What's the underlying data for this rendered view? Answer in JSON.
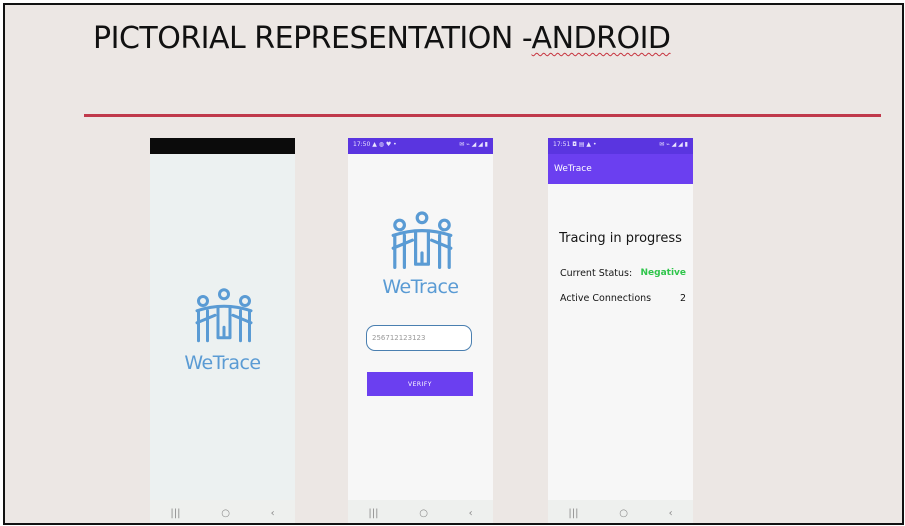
{
  "slide": {
    "title_prefix": "PICTORIAL REPRESENTATION -",
    "title_squiggle": "ANDROID"
  },
  "colors": {
    "accent_rule": "#c0394b",
    "app_purple": "#6b3ff0",
    "logo_blue": "#5a9bd4",
    "status_negative": "#2fc54b"
  },
  "phones": {
    "splash": {
      "logo_icon": "people-group-icon",
      "logo_text": "WeTrace",
      "nav": [
        "|||",
        "○",
        "‹"
      ]
    },
    "login": {
      "status_time": "17:50 ▲ ◍ ♥ •",
      "status_icons": "✉ ⌁ ◢ ◢ ▮",
      "logo_icon": "people-group-icon",
      "logo_text": "WeTrace",
      "phone_input_value": "256712123123",
      "verify_label": "VERIFY",
      "nav": [
        "|||",
        "○",
        "‹"
      ]
    },
    "status": {
      "status_time": "17:51 ◘ ▤ ▲ •",
      "status_icons": "✉ ⌁ ◢ ◢ ▮",
      "app_title": "WeTrace",
      "heading": "Tracing in progress",
      "current_status_label": "Current Status:",
      "current_status_value": "Negative",
      "active_connections_label": "Active Connections",
      "active_connections_value": "2",
      "nav": [
        "|||",
        "○",
        "‹"
      ]
    }
  }
}
